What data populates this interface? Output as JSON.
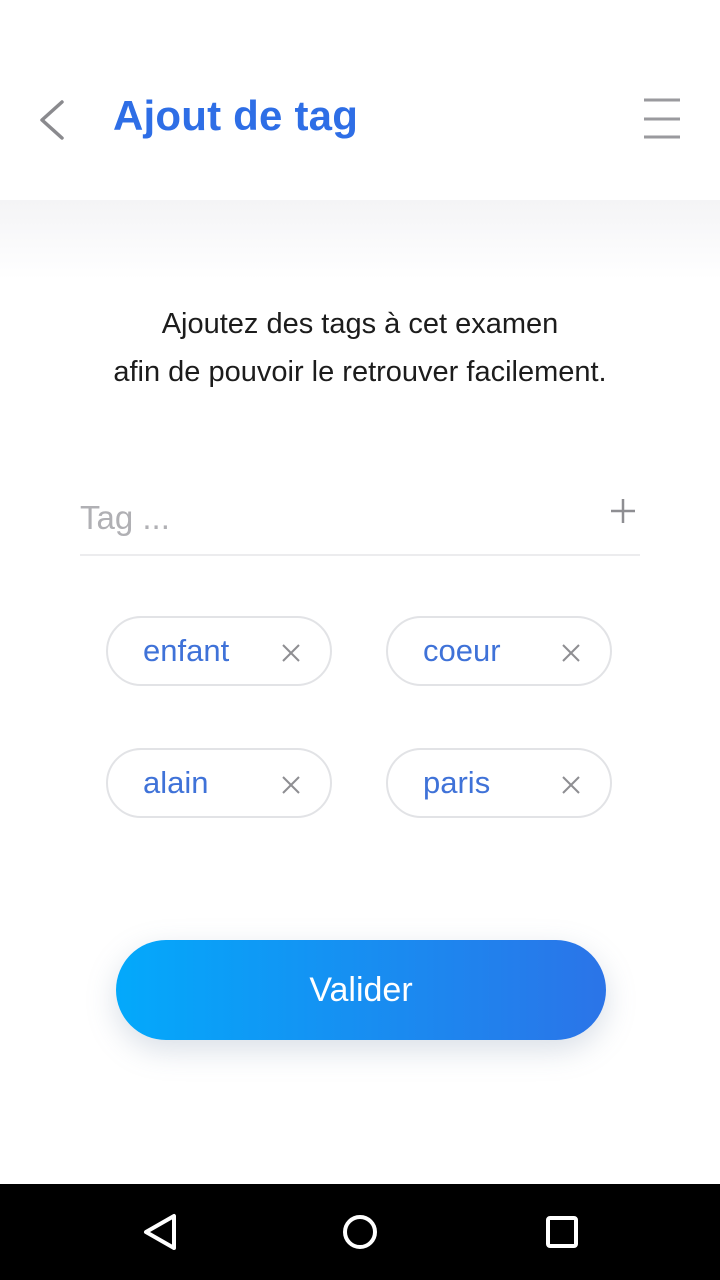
{
  "header": {
    "title": "Ajout de tag",
    "back_icon": "chevron-left-icon",
    "menu_icon": "hamburger-menu-icon"
  },
  "intro": {
    "line1": "Ajoutez des tags à cet examen",
    "line2": "afin de pouvoir le retrouver facilement."
  },
  "tag_input": {
    "value": "",
    "placeholder": "Tag ...",
    "add_icon": "plus-icon"
  },
  "tags": [
    {
      "label": "enfant"
    },
    {
      "label": "coeur"
    },
    {
      "label": "alain"
    },
    {
      "label": "paris"
    }
  ],
  "validate_button": {
    "label": "Valider"
  },
  "colors": {
    "accent": "#2e6ee6",
    "chip_text": "#3f72d8",
    "button_gradient_start": "#03a9fb",
    "button_gradient_end": "#2b74e8"
  },
  "system_nav": {
    "back_icon": "triangle-back-icon",
    "home_icon": "circle-home-icon",
    "recents_icon": "square-recents-icon"
  }
}
